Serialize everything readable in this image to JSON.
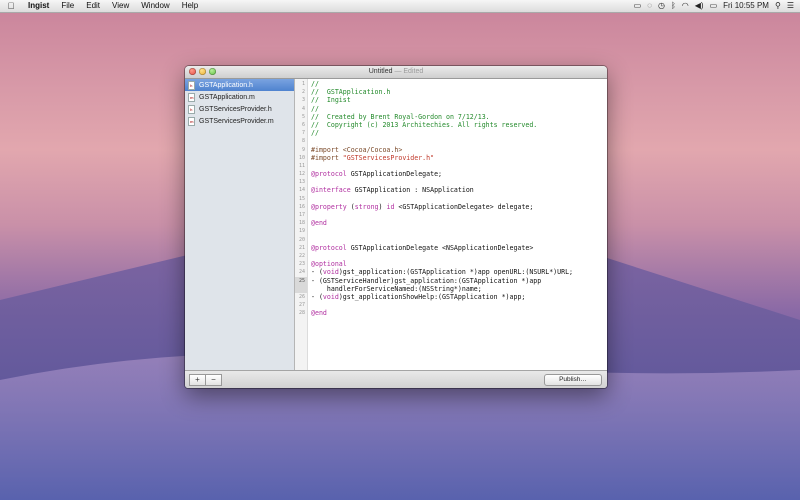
{
  "menubar": {
    "apple": "",
    "app_name": "Ingist",
    "menus": [
      "File",
      "Edit",
      "View",
      "Window",
      "Help"
    ],
    "status_icons": [
      "airplay-icon",
      "sync-icon",
      "time-machine-icon",
      "bluetooth-icon",
      "wifi-icon",
      "volume-icon",
      "battery-icon"
    ],
    "clock": "Fri 10:55 PM"
  },
  "window": {
    "title": "Untitled",
    "edited": "— Edited"
  },
  "sidebar": {
    "files": [
      {
        "name": "GSTApplication.h",
        "ext": "h",
        "selected": true
      },
      {
        "name": "GSTApplication.m",
        "ext": "m",
        "selected": false
      },
      {
        "name": "GSTServicesProvider.h",
        "ext": "h",
        "selected": false
      },
      {
        "name": "GSTServicesProvider.m",
        "ext": "m",
        "selected": false
      }
    ]
  },
  "editor": {
    "line_numbers": [
      "1",
      "2",
      "3",
      "4",
      "5",
      "6",
      "7",
      "8",
      "9",
      "10",
      "11",
      "12",
      "13",
      "14",
      "15",
      "16",
      "17",
      "18",
      "19",
      "20",
      "21",
      "22",
      "23",
      "24",
      "25",
      "",
      "26",
      "27",
      "28"
    ],
    "lines": [
      "//",
      "//  GSTApplication.h",
      "//  Ingist",
      "//",
      "//  Created by Brent Royal-Gordon on 7/12/13.",
      "//  Copyright (c) 2013 Architechies. All rights reserved.",
      "//",
      "",
      "#import <Cocoa/Cocoa.h>",
      "#import \"GSTServicesProvider.h\"",
      "",
      "@protocol GSTApplicationDelegate;",
      "",
      "@interface GSTApplication : NSApplication",
      "",
      "@property (strong) id <GSTApplicationDelegate> delegate;",
      "",
      "@end",
      "",
      "",
      "@protocol GSTApplicationDelegate <NSApplicationDelegate>",
      "",
      "@optional",
      "- (void)gst_application:(GSTApplication *)app openURL:(NSURL*)URL;",
      "- (GSTServiceHandler)gst_application:(GSTApplication *)app",
      "    handlerForServiceNamed:(NSString*)name;",
      "- (void)gst_applicationShowHelp:(GSTApplication *)app;",
      "",
      "@end"
    ]
  },
  "bottombar": {
    "add": "+",
    "remove": "−",
    "publish": "Publish…"
  }
}
